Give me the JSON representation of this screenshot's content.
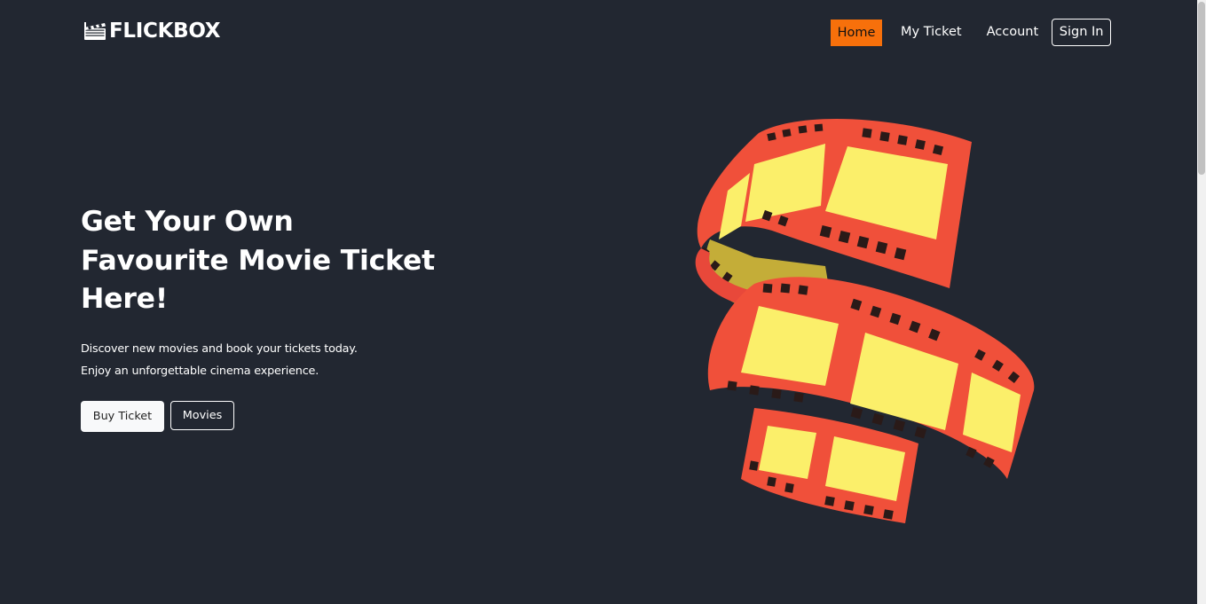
{
  "brand": {
    "name": "FLICKBOX",
    "logo_icon": "clapperboard-icon"
  },
  "nav": {
    "items": [
      {
        "label": "Home",
        "active": true
      },
      {
        "label": "My Ticket",
        "active": false
      },
      {
        "label": "Account",
        "active": false
      }
    ],
    "signin_label": "Sign In"
  },
  "hero": {
    "title_lines": [
      "Get Your Own",
      "Favourite Movie Ticket",
      "Here!"
    ],
    "description_lines": [
      "Discover new movies and book your tickets today.",
      "Enjoy an unforgettable cinema experience."
    ],
    "buy_button_label": "Buy Ticket",
    "movies_button_label": "Movies",
    "image_icon": "film-reel-illustration"
  },
  "colors": {
    "background": "#222731",
    "accent": "#f7700b",
    "text": "#ffffff",
    "film_red": "#f0503a",
    "film_yellow": "#fbef6a"
  }
}
